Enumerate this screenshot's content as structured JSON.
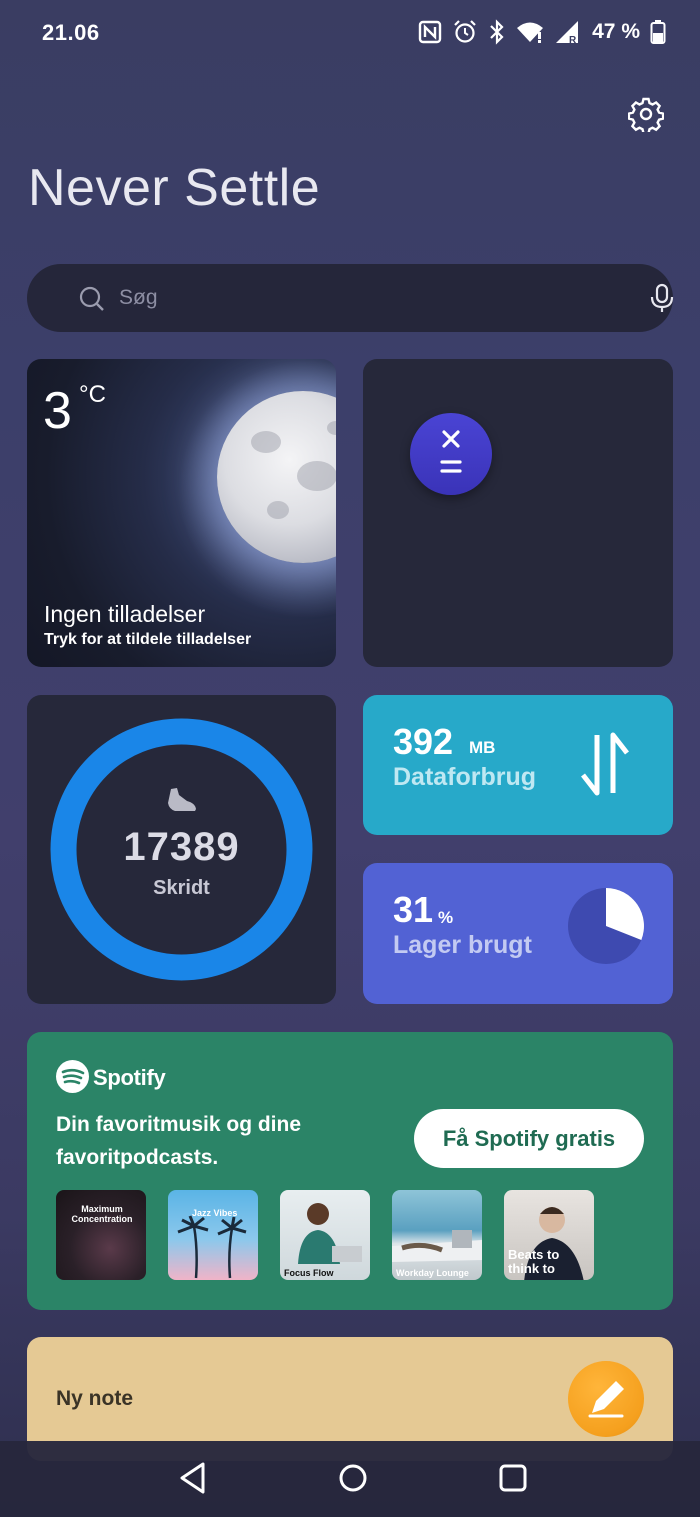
{
  "status_bar": {
    "time": "21.06",
    "battery": "47 %",
    "icons": [
      "nfc-icon",
      "alarm-icon",
      "bluetooth-icon",
      "wifi-icon",
      "signal-icon",
      "battery-icon"
    ]
  },
  "header": {
    "title": "Never Settle",
    "settings_icon": "gear-icon"
  },
  "search": {
    "placeholder": "Søg",
    "icon": "search-icon",
    "mic_icon": "mic-icon"
  },
  "weather_widget": {
    "temperature": "3",
    "unit": "°C",
    "title": "Ingen tilladelser",
    "subtitle": "Tryk for at tildele tilladelser"
  },
  "calculator_widget": {
    "icon": "calculator-icon"
  },
  "steps_widget": {
    "count": "17389",
    "label": "Skridt",
    "icon": "shoe-icon",
    "ring_color": "#1a86e8"
  },
  "data_widget": {
    "value": "392",
    "unit": "MB",
    "label": "Dataforbrug",
    "color": "#27a9c9"
  },
  "storage_widget": {
    "value": "31",
    "unit": "%",
    "label": "Lager brugt",
    "used_fraction": 0.31,
    "color": "#5262d4"
  },
  "spotify_widget": {
    "brand": "Spotify",
    "text": "Din favoritmusik og dine favoritpodcasts.",
    "button": "Få Spotify gratis",
    "color": "#2b8467",
    "covers": [
      {
        "title": "Maximum Concentration"
      },
      {
        "title": "Jazz Vibes"
      },
      {
        "title": "Focus Flow"
      },
      {
        "title": "Workday Lounge"
      },
      {
        "title": "Beats to think to"
      }
    ]
  },
  "note_widget": {
    "label": "Ny note",
    "icon": "pencil-icon",
    "color": "#e5c994"
  },
  "nav_bar": {
    "buttons": [
      "back-icon",
      "home-icon",
      "recents-icon"
    ]
  }
}
